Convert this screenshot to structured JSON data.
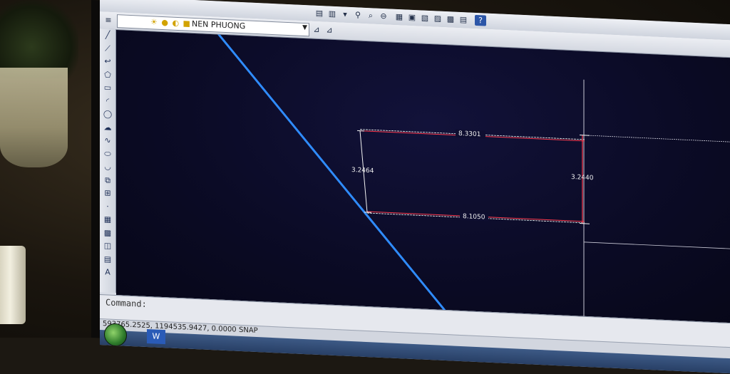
{
  "toolbar": {
    "icons": [
      "layer-properties-icon",
      "zoom-realtime-icon",
      "zoom-window-icon",
      "zoom-previous-icon",
      "properties-icon",
      "design-center-icon",
      "tool-palettes-icon",
      "sheet-set-icon",
      "markup-icon",
      "quickcalc-icon",
      "help-icon"
    ]
  },
  "layer": {
    "current": "NEN PHUONG"
  },
  "draw_tools": [
    "line",
    "construction-line",
    "polyline",
    "polygon",
    "rectangle",
    "arc",
    "circle",
    "revision-cloud",
    "spline",
    "ellipse",
    "ellipse-arc",
    "insert-block",
    "make-block",
    "point",
    "hatch",
    "gradient",
    "region",
    "table",
    "multiline-text"
  ],
  "tool_glyphs": [
    "╱",
    "⟋",
    "↩",
    "⬠",
    "▭",
    "◜",
    "◯",
    "☁",
    "∿",
    "⬭",
    "◡",
    "⧉",
    "⊞",
    "·",
    "▦",
    "▩",
    "◫",
    "▤",
    "A"
  ],
  "drawing": {
    "dimensions": {
      "top": "8.3301",
      "bottom": "8.1050",
      "left": "3.2464",
      "right": "3.2440"
    },
    "colors": {
      "background": "#0b0b26",
      "boundary_line": "#2f8cff",
      "dimension": "#f2f2f2",
      "edge_red": "#ff3b4e"
    }
  },
  "command": {
    "prompt": "Command:"
  },
  "status": {
    "coordinates": "593765.2525, 1194535.9427, 0.0000",
    "snap": "SNAP"
  },
  "taskbar": {
    "word_label": "W"
  }
}
